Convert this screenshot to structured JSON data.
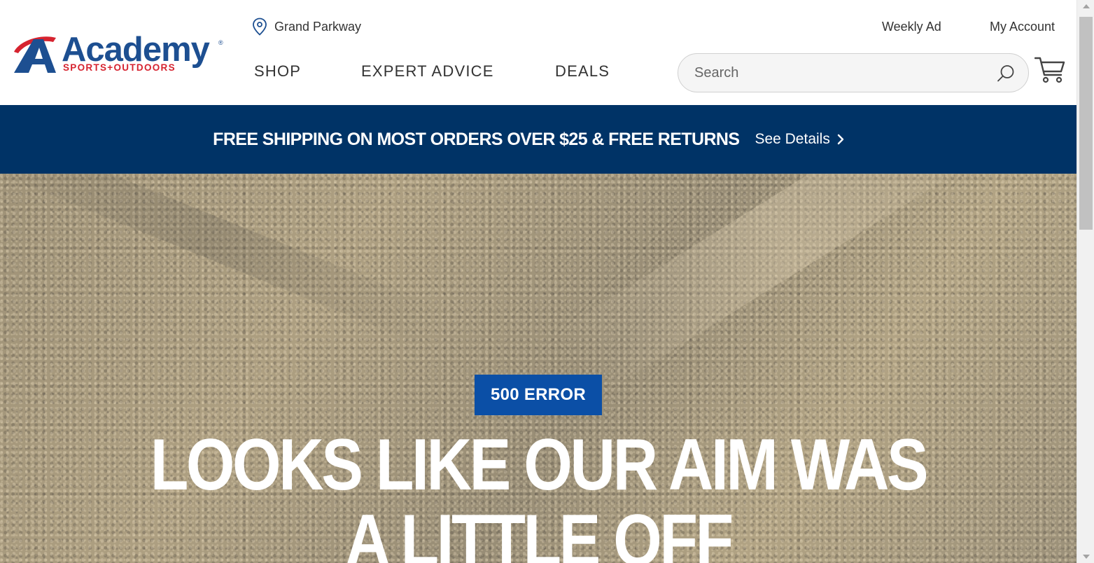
{
  "header": {
    "logo": {
      "name": "Academy",
      "tagline": "SPORTS+OUTDOORS",
      "registered": "®"
    },
    "store": {
      "icon": "location-pin-icon",
      "name": "Grand Parkway"
    },
    "links": {
      "weekly_ad": "Weekly Ad",
      "my_account": "My Account"
    },
    "nav": {
      "shop": "SHOP",
      "expert_advice": "EXPERT ADVICE",
      "deals": "DEALS"
    },
    "search": {
      "placeholder": "Search",
      "value": "",
      "icon": "search-icon"
    },
    "cart": {
      "icon": "cart-icon"
    }
  },
  "promo": {
    "message": "FREE SHIPPING ON MOST ORDERS OVER $25 & FREE RETURNS",
    "details_label": "See Details",
    "details_icon": "chevron-right-icon"
  },
  "hero": {
    "badge": "500 ERROR",
    "headline": "LOOKS LIKE OUR AIM WAS A LITTLE OFF"
  },
  "colors": {
    "brand_blue": "#1d4f91",
    "brand_red": "#d6232f",
    "promo_bg": "#003366",
    "badge_bg": "#0b4fa6"
  }
}
